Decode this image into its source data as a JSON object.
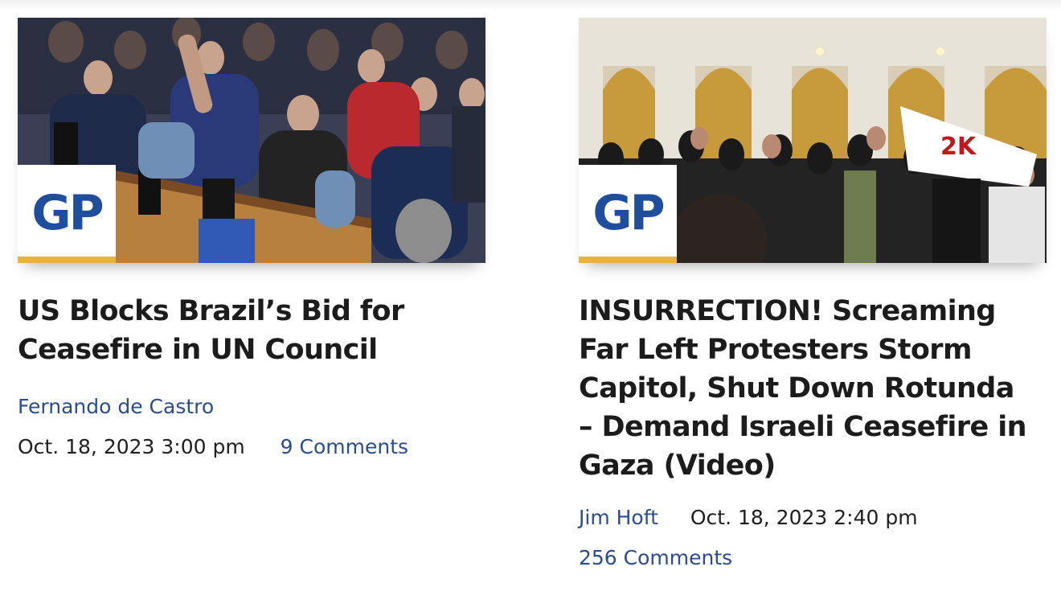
{
  "articles": [
    {
      "thumbnail": {
        "alt": "UN Security Council vote",
        "badge": "GP"
      },
      "title": "US Blocks Brazil’s Bid for Ceasefire in UN Council",
      "author": "Fernando de Castro",
      "date": "Oct. 18, 2023 3:00 pm",
      "comments": "9 Comments"
    },
    {
      "thumbnail": {
        "alt": "Protesters in Capitol rotunda",
        "badge": "GP"
      },
      "title": "INSURRECTION! Screaming Far Left Protesters Storm Capitol, Shut Down Rotunda – Demand Israeli Ceasefire in Gaza (Video)",
      "author": "Jim Hoft",
      "date": "Oct. 18, 2023 2:40 pm",
      "comments": "256 Comments"
    }
  ],
  "colors": {
    "link": "#2a4d8f",
    "badge_text": "#1f4e9c",
    "badge_underline": "#e9b33a"
  }
}
